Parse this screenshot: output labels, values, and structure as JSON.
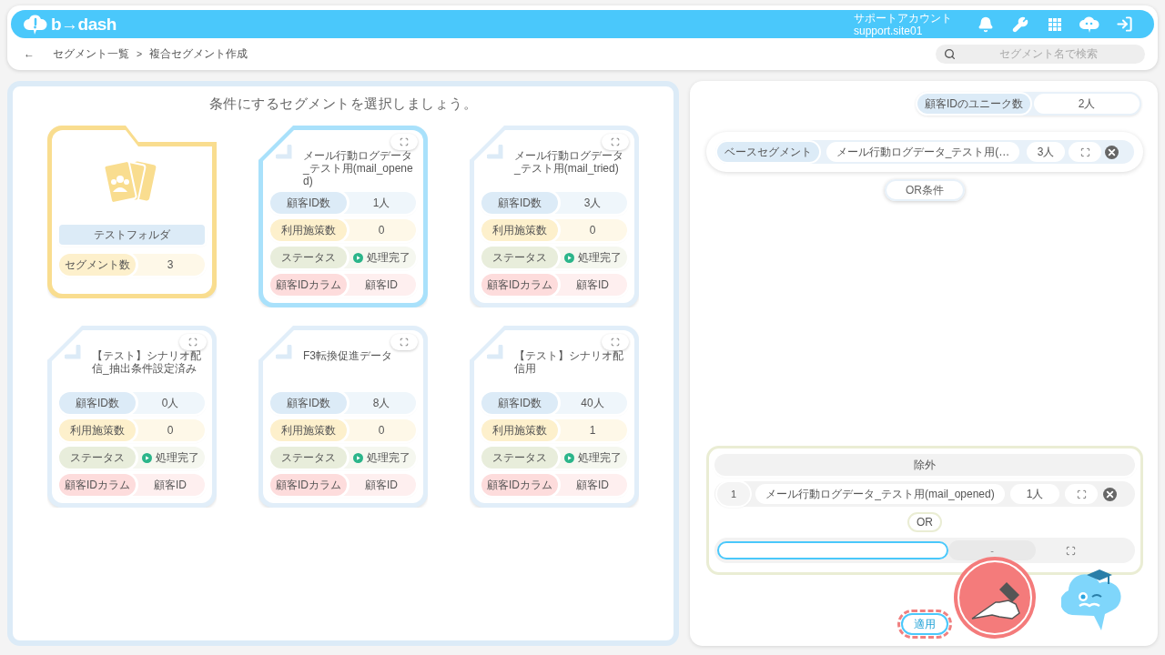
{
  "header": {
    "logo": "b→dash",
    "account_name": "サポートアカウント",
    "account_id": "support.site01"
  },
  "breadcrumb": {
    "back": "←",
    "items": [
      "セグメント一覧",
      "複合セグメント作成"
    ],
    "separator": ">"
  },
  "search": {
    "placeholder": "セグメント名で検索"
  },
  "left_panel": {
    "title": "条件にするセグメントを選択しましょう。",
    "cards": [
      {
        "kind": "folder",
        "name": "テストフォルダ",
        "stats": [
          {
            "kind": "text",
            "label": "セグメント数",
            "value": "3",
            "color": "#fdf0cc"
          }
        ]
      },
      {
        "kind": "segment",
        "selected": true,
        "title": "メール行動ログデータ_テスト用(mail_opened)",
        "stats": [
          {
            "kind": "text",
            "label": "顧客ID数",
            "value": "1人",
            "color": "#dcebf7"
          },
          {
            "kind": "text",
            "label": "利用施策数",
            "value": "0",
            "color": "#fdf0cc"
          },
          {
            "kind": "status",
            "label": "ステータス",
            "value": "処理完了",
            "color": "#e8eddb"
          },
          {
            "kind": "text",
            "label": "顧客IDカラム",
            "value": "顧客ID",
            "color": "#fddcdc"
          }
        ]
      },
      {
        "kind": "segment",
        "selected": false,
        "title": "メール行動ログデータ_テスト用(mail_tried)",
        "stats": [
          {
            "kind": "text",
            "label": "顧客ID数",
            "value": "3人",
            "color": "#dcebf7"
          },
          {
            "kind": "text",
            "label": "利用施策数",
            "value": "0",
            "color": "#fdf0cc"
          },
          {
            "kind": "status",
            "label": "ステータス",
            "value": "処理完了",
            "color": "#e8eddb"
          },
          {
            "kind": "text",
            "label": "顧客IDカラム",
            "value": "顧客ID",
            "color": "#fddcdc"
          }
        ]
      },
      {
        "kind": "segment",
        "selected": false,
        "title": "【テスト】シナリオ配信_抽出条件設定済み",
        "stats": [
          {
            "kind": "text",
            "label": "顧客ID数",
            "value": "0人",
            "color": "#dcebf7"
          },
          {
            "kind": "text",
            "label": "利用施策数",
            "value": "0",
            "color": "#fdf0cc"
          },
          {
            "kind": "status",
            "label": "ステータス",
            "value": "処理完了",
            "color": "#e8eddb"
          },
          {
            "kind": "text",
            "label": "顧客IDカラム",
            "value": "顧客ID",
            "color": "#fddcdc"
          }
        ]
      },
      {
        "kind": "segment",
        "selected": false,
        "title": "F3転換促進データ",
        "stats": [
          {
            "kind": "text",
            "label": "顧客ID数",
            "value": "8人",
            "color": "#dcebf7"
          },
          {
            "kind": "text",
            "label": "利用施策数",
            "value": "0",
            "color": "#fdf0cc"
          },
          {
            "kind": "status",
            "label": "ステータス",
            "value": "処理完了",
            "color": "#e8eddb"
          },
          {
            "kind": "text",
            "label": "顧客IDカラム",
            "value": "顧客ID",
            "color": "#fddcdc"
          }
        ]
      },
      {
        "kind": "segment",
        "selected": false,
        "title": "【テスト】シナリオ配信用",
        "stats": [
          {
            "kind": "text",
            "label": "顧客ID数",
            "value": "40人",
            "color": "#dcebf7"
          },
          {
            "kind": "text",
            "label": "利用施策数",
            "value": "1",
            "color": "#fdf0cc"
          },
          {
            "kind": "status",
            "label": "ステータス",
            "value": "処理完了",
            "color": "#e8eddb"
          },
          {
            "kind": "text",
            "label": "顧客IDカラム",
            "value": "顧客ID",
            "color": "#fddcdc"
          }
        ]
      }
    ]
  },
  "right_panel": {
    "unique_count": {
      "label": "顧客IDのユニーク数",
      "value": "2人"
    },
    "base_segment": {
      "label": "ベースセグメント",
      "name": "メール行動ログデータ_テスト用(…",
      "count": "3人"
    },
    "or_condition_button": "OR条件",
    "exclusion": {
      "title": "除外",
      "rows": [
        {
          "index": "1",
          "name": "メール行動ログデータ_テスト用(mail_opened)",
          "count": "1人"
        }
      ],
      "or_label": "OR",
      "empty_row": {
        "focused": true,
        "count": "-"
      }
    },
    "apply_button": {
      "label": "適用",
      "highlighted": true
    }
  }
}
